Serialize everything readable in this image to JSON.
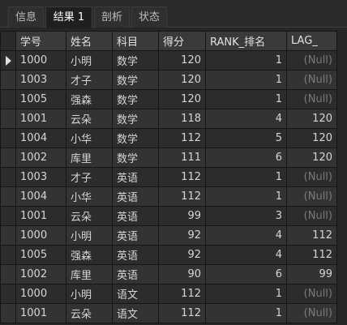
{
  "tabs": [
    {
      "label": "信息"
    },
    {
      "label": "结果 1"
    },
    {
      "label": "剖析"
    },
    {
      "label": "状态"
    }
  ],
  "columns": [
    "学号",
    "姓名",
    "科目",
    "得分",
    "RANK_排名",
    "LAG_"
  ],
  "rows": [
    [
      "1000",
      "小明",
      "数学",
      "120",
      "1",
      "(Null)"
    ],
    [
      "1003",
      "才子",
      "数学",
      "120",
      "1",
      "(Null)"
    ],
    [
      "1005",
      "强森",
      "数学",
      "120",
      "1",
      "(Null)"
    ],
    [
      "1001",
      "云朵",
      "数学",
      "118",
      "4",
      "120"
    ],
    [
      "1004",
      "小华",
      "数学",
      "112",
      "5",
      "120"
    ],
    [
      "1002",
      "库里",
      "数学",
      "111",
      "6",
      "120"
    ],
    [
      "1003",
      "才子",
      "英语",
      "112",
      "1",
      "(Null)"
    ],
    [
      "1004",
      "小华",
      "英语",
      "112",
      "1",
      "(Null)"
    ],
    [
      "1001",
      "云朵",
      "英语",
      "99",
      "3",
      "(Null)"
    ],
    [
      "1000",
      "小明",
      "英语",
      "92",
      "4",
      "112"
    ],
    [
      "1005",
      "强森",
      "英语",
      "92",
      "4",
      "112"
    ],
    [
      "1002",
      "库里",
      "英语",
      "90",
      "6",
      "99"
    ],
    [
      "1000",
      "小明",
      "语文",
      "112",
      "1",
      "(Null)"
    ],
    [
      "1001",
      "云朵",
      "语文",
      "112",
      "1",
      "(Null)"
    ]
  ],
  "active_tab": 1,
  "current_row": 0
}
